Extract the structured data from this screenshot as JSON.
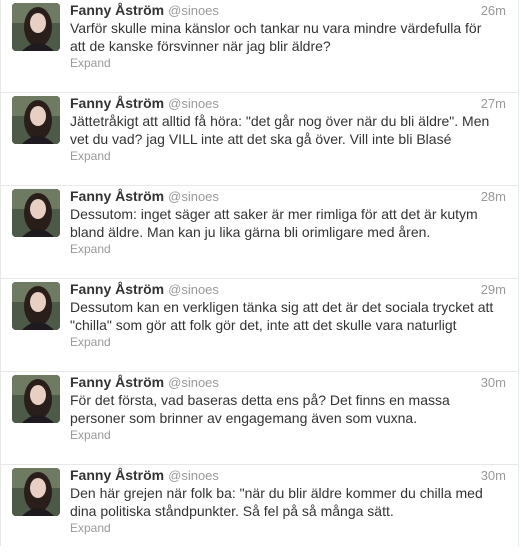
{
  "tweets": [
    {
      "name": "Fanny Åström",
      "handle": "@sinoes",
      "time": "26m",
      "text": "Varför skulle mina känslor och tankar nu vara mindre värdefulla för att de kanske försvinner när jag blir äldre?",
      "expand": "Expand"
    },
    {
      "name": "Fanny Åström",
      "handle": "@sinoes",
      "time": "27m",
      "text": "Jättetråkigt att alltid få höra: \"det går nog över när du bli äldre\". Men vet du vad? jag VILL inte att det ska gå över. Vill inte bli Blasé",
      "expand": "Expand"
    },
    {
      "name": "Fanny Åström",
      "handle": "@sinoes",
      "time": "28m",
      "text": "Dessutom: inget säger att saker är mer rimliga för att det är kutym bland äldre. Man kan ju lika gärna bli orimligare med åren.",
      "expand": "Expand"
    },
    {
      "name": "Fanny Åström",
      "handle": "@sinoes",
      "time": "29m",
      "text": "Dessutom kan en verkligen tänka sig att det är det sociala trycket att \"chilla\" som gör att folk gör det, inte att det skulle vara naturligt",
      "expand": "Expand"
    },
    {
      "name": "Fanny Åström",
      "handle": "@sinoes",
      "time": "30m",
      "text": "För det första, vad baseras detta ens på? Det finns en massa personer som brinner av engagemang även som vuxna.",
      "expand": "Expand"
    },
    {
      "name": "Fanny Åström",
      "handle": "@sinoes",
      "time": "30m",
      "text": "Den här grejen när folk ba: \"när du blir äldre kommer du chilla med dina politiska ståndpunkter. Så fel på så många sätt.",
      "expand": "Expand"
    }
  ]
}
